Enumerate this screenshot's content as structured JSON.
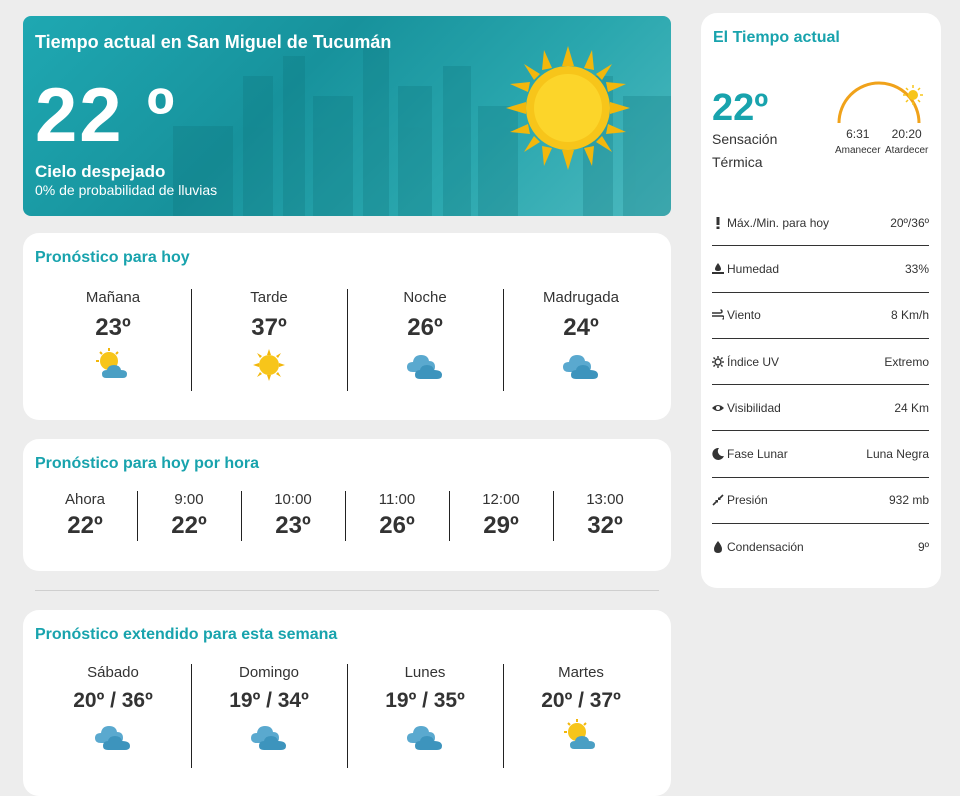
{
  "hero": {
    "title": "Tiempo actual en San Miguel de Tucumán",
    "temp": "22 º",
    "condition": "Cielo despejado",
    "rain": "0% de probabilidad de lluvias",
    "icon": "sun-icon"
  },
  "today": {
    "title": "Pronóstico para hoy",
    "periods": [
      {
        "label": "Mañana",
        "temp": "23º",
        "icon": "sun-cloud-icon"
      },
      {
        "label": "Tarde",
        "temp": "37º",
        "icon": "sun-icon"
      },
      {
        "label": "Noche",
        "temp": "26º",
        "icon": "cloud-icon"
      },
      {
        "label": "Madrugada",
        "temp": "24º",
        "icon": "cloud-icon"
      }
    ]
  },
  "hourly": {
    "title": "Pronóstico para hoy por hora",
    "hours": [
      {
        "label": "Ahora",
        "temp": "22º"
      },
      {
        "label": "9:00",
        "temp": "22º"
      },
      {
        "label": "10:00",
        "temp": "23º"
      },
      {
        "label": "11:00",
        "temp": "26º"
      },
      {
        "label": "12:00",
        "temp": "29º"
      },
      {
        "label": "13:00",
        "temp": "32º"
      }
    ]
  },
  "week": {
    "title": "Pronóstico extendido para esta semana",
    "days": [
      {
        "label": "Sábado",
        "temp": "20º / 36º",
        "icon": "cloud-icon"
      },
      {
        "label": "Domingo",
        "temp": "19º / 34º",
        "icon": "cloud-icon"
      },
      {
        "label": "Lunes",
        "temp": "19º / 35º",
        "icon": "cloud-icon"
      },
      {
        "label": "Martes",
        "temp": "20º / 37º",
        "icon": "sun-cloud-icon"
      }
    ]
  },
  "current": {
    "title": "El Tiempo actual",
    "temp": "22º",
    "sensation": "Sensación Térmica",
    "sunrise_time": "6:31",
    "sunrise_label": "Amanecer",
    "sunset_time": "20:20",
    "sunset_label": "Atardecer",
    "rows": [
      {
        "icon": "exclamation-icon",
        "label": "Máx./Min. para hoy",
        "value": "20º/36º"
      },
      {
        "icon": "humidity-icon",
        "label": "Humedad",
        "value": "33%"
      },
      {
        "icon": "wind-icon",
        "label": "Viento",
        "value": "8 Km/h"
      },
      {
        "icon": "sun-uv-icon",
        "label": "Índice UV",
        "value": "Extremo"
      },
      {
        "icon": "eye-icon",
        "label": "Visibilidad",
        "value": "24 Km"
      },
      {
        "icon": "moon-icon",
        "label": "Fase Lunar",
        "value": "Luna Negra"
      },
      {
        "icon": "compress-icon",
        "label": "Presión",
        "value": "932 mb"
      },
      {
        "icon": "drop-icon",
        "label": "Condensación",
        "value": "9º"
      }
    ]
  },
  "colors": {
    "accent": "#18a3ad",
    "sun": "#f7c51a",
    "cloud": "#4a9fc4",
    "arc": "#f0a21a"
  }
}
